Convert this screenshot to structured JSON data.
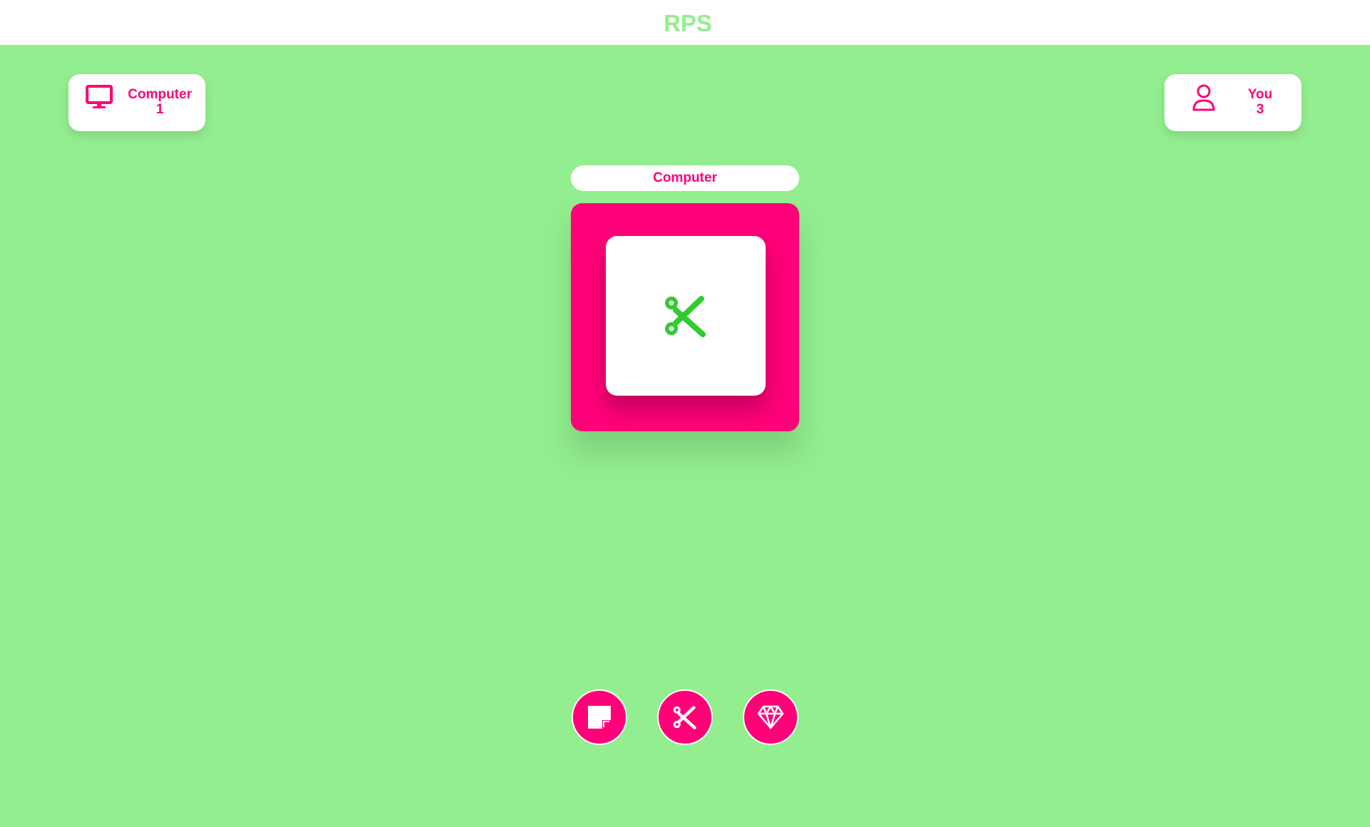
{
  "header": {
    "title": "RPS"
  },
  "scores": {
    "computer": {
      "label": "Computer",
      "value": "1",
      "icon": "monitor-icon"
    },
    "you": {
      "label": "You",
      "value": "3",
      "icon": "user-icon"
    }
  },
  "turn": {
    "label": "Computer"
  },
  "stage": {
    "current_choice": "scissors",
    "icon": "scissors-icon"
  },
  "choices": [
    {
      "name": "paper",
      "icon": "sticky-note-icon"
    },
    {
      "name": "scissors",
      "icon": "scissors-icon"
    },
    {
      "name": "rock",
      "icon": "gem-icon"
    }
  ],
  "colors": {
    "background": "#93ee8f",
    "accent": "#ff0078",
    "icon_green": "#2ecc2e",
    "white": "#ffffff"
  }
}
